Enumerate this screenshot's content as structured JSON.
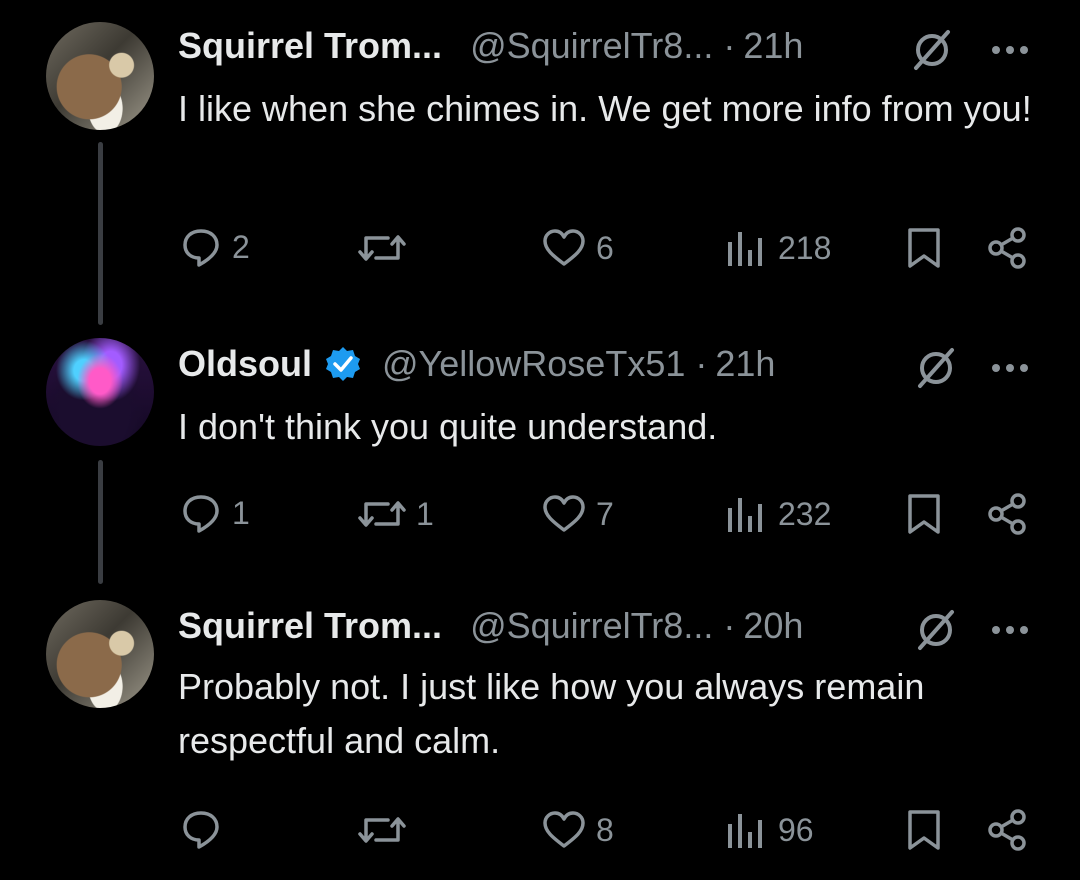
{
  "tweets": [
    {
      "name": "Squirrel Trom...",
      "handle": "@SquirrelTr8...",
      "time": "21h",
      "text": "I like when she chimes in. We get more info from you!",
      "replies": "2",
      "reposts": "",
      "likes": "6",
      "views": "218",
      "verified": false,
      "avatar": "squirrel-avatar"
    },
    {
      "name": "Oldsoul",
      "handle": "@YellowRoseTx51",
      "time": "21h",
      "text": "I don't think you quite understand.",
      "replies": "1",
      "reposts": "1",
      "likes": "7",
      "views": "232",
      "verified": true,
      "avatar": "aurora-avatar"
    },
    {
      "name": "Squirrel Trom...",
      "handle": "@SquirrelTr8...",
      "time": "20h",
      "text": "Probably not. I just like how you always remain respectful and calm.",
      "replies": "",
      "reposts": "",
      "likes": "8",
      "views": "96",
      "verified": false,
      "avatar": "squirrel-avatar"
    }
  ],
  "separator": "·",
  "colors": {
    "background": "#000000",
    "text": "#e7e9ea",
    "muted": "#8b9399",
    "verified_badge": "#1d9bf0",
    "thread_line": "#3a3d42"
  }
}
